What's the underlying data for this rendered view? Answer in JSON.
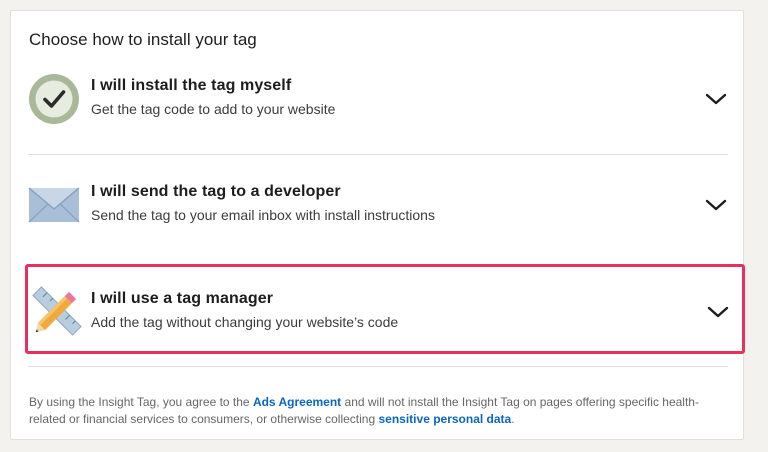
{
  "page": {
    "title": "Choose how to install your tag"
  },
  "options": [
    {
      "title": "I will install the tag myself",
      "description": "Get the tag code to add to your website",
      "icon": "check-circle-icon"
    },
    {
      "title": "I will send the tag to a developer",
      "description": "Send the tag to your email inbox with install instructions",
      "icon": "envelope-icon"
    },
    {
      "title": "I will use a tag manager",
      "description": "Add the tag without changing your website’s code",
      "icon": "pencil-ruler-icon"
    }
  ],
  "legal": {
    "part1": "By using the Insight Tag, you agree to the ",
    "link1": "Ads Agreement",
    "part2": " and will not install the Insight Tag on pages offering specific health-related or financial services to consumers, or otherwise collecting ",
    "link2": "sensitive personal data",
    "part3": "."
  },
  "colors": {
    "highlight_border": "#e8305f",
    "link": "#0a66c2",
    "check_ring": "#a8b898",
    "envelope": "#9db4d0"
  }
}
